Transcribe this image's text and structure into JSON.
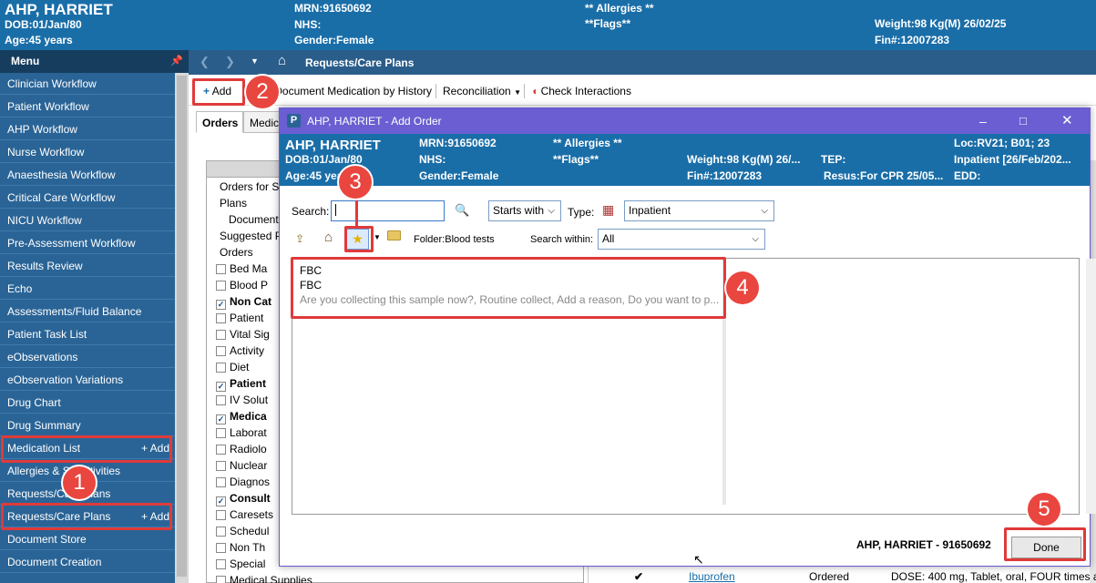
{
  "banner": {
    "name": "AHP, HARRIET",
    "dob": "DOB:01/Jan/80",
    "age": "Age:45 years",
    "mrn": "MRN:91650692",
    "nhs": "NHS:",
    "gender": "Gender:Female",
    "allergies": "** Allergies **",
    "flags": "**Flags**",
    "weight": "Weight:98 Kg(M) 26/02/25",
    "fin": "Fin#:12007283"
  },
  "sidebar": {
    "menu_label": "Menu",
    "add_label": "Add",
    "items": [
      {
        "label": "Clinician Workflow"
      },
      {
        "label": "Patient Workflow"
      },
      {
        "label": "AHP Workflow"
      },
      {
        "label": "Nurse Workflow"
      },
      {
        "label": "Anaesthesia Workflow"
      },
      {
        "label": "Critical Care Workflow"
      },
      {
        "label": "NICU Workflow"
      },
      {
        "label": "Pre-Assessment Workflow"
      },
      {
        "label": "Results Review"
      },
      {
        "label": "Echo"
      },
      {
        "label": "Assessments/Fluid Balance"
      },
      {
        "label": "Patient Task List"
      },
      {
        "label": "eObservations"
      },
      {
        "label": "eObservation Variations"
      },
      {
        "label": "Drug Chart"
      },
      {
        "label": "Drug Summary"
      },
      {
        "label": "Medication List"
      },
      {
        "label": "Allergies & Sensitivities"
      },
      {
        "label": "Requests/Care Plans"
      },
      {
        "label": "Requests/Care Plans"
      },
      {
        "label": "Document Store"
      },
      {
        "label": "Document Creation"
      }
    ]
  },
  "main": {
    "page_title": "Requests/Care Plans",
    "toolbar": {
      "add": "Add",
      "document_medication": "Document Medication by History",
      "reconciliation": "Reconciliation",
      "check_interactions": "Check Interactions"
    },
    "tabs": [
      "Orders",
      "Medic"
    ],
    "tree": [
      {
        "label": "Orders for Si",
        "type": "node"
      },
      {
        "label": "Plans",
        "type": "node"
      },
      {
        "label": "Document",
        "type": "node"
      },
      {
        "label": "Suggested P",
        "type": "node"
      },
      {
        "label": "Orders",
        "type": "node"
      },
      {
        "label": "Bed Ma",
        "checked": false,
        "bold": false
      },
      {
        "label": "Blood P",
        "checked": false,
        "bold": false
      },
      {
        "label": "Non Cat",
        "checked": true,
        "bold": true
      },
      {
        "label": "Patient",
        "checked": false,
        "bold": false
      },
      {
        "label": "Vital Sig",
        "checked": false,
        "bold": false
      },
      {
        "label": "Activity",
        "checked": false,
        "bold": false
      },
      {
        "label": "Diet",
        "checked": false,
        "bold": false
      },
      {
        "label": "Patient",
        "checked": true,
        "bold": true
      },
      {
        "label": "IV Solut",
        "checked": false,
        "bold": false
      },
      {
        "label": "Medica",
        "checked": true,
        "bold": true
      },
      {
        "label": "Laborat",
        "checked": false,
        "bold": false
      },
      {
        "label": "Radiolo",
        "checked": false,
        "bold": false
      },
      {
        "label": "Nuclear",
        "checked": false,
        "bold": false
      },
      {
        "label": "Diagnos",
        "checked": false,
        "bold": false
      },
      {
        "label": "Consult",
        "checked": true,
        "bold": true
      },
      {
        "label": "Caresets",
        "checked": false,
        "bold": false
      },
      {
        "label": "Schedul",
        "checked": false,
        "bold": false
      },
      {
        "label": "Non Th",
        "checked": false,
        "bold": false
      },
      {
        "label": "Special",
        "checked": false,
        "bold": false
      },
      {
        "label": "Medical Supplies",
        "checked": false,
        "bold": false
      }
    ],
    "bottom_row": {
      "drug": "Ibuprofen",
      "status": "Ordered",
      "details": "DOSE: 400 mg, Tablet, oral, FOUR times a"
    }
  },
  "dialog": {
    "title": "AHP, HARRIET  - Add Order",
    "banner": {
      "name": "AHP, HARRIET",
      "dob": "DOB:01/Jan/80",
      "age": "Age:45 years",
      "mrn": "MRN:91650692",
      "nhs": "NHS:",
      "gender": "Gender:Female",
      "allergies": "** Allergies **",
      "flags": "**Flags**",
      "weight": "Weight:98 Kg(M) 26/...",
      "fin": "Fin#:12007283",
      "tep": "TEP:",
      "resus": "Resus:For CPR  25/05...",
      "loc": "Loc:RV21; B01; 23",
      "inpatient": "Inpatient [26/Feb/202...",
      "edd": "EDD:"
    },
    "search_label": "Search:",
    "search_value": "",
    "match_mode": "Starts with",
    "type_label": "Type:",
    "type_value": "Inpatient",
    "folder_label": "Folder:",
    "folder_value": "Blood tests",
    "search_within_label": "Search within:",
    "search_within_value": "All",
    "results": {
      "title": "FBC",
      "name": "FBC",
      "detail": "Are you collecting this sample now?, Routine collect, Add a reason, Do you want to p..."
    },
    "footer_patient": "AHP, HARRIET   - 91650692",
    "done": "Done"
  },
  "annotations": [
    "1",
    "2",
    "3",
    "4",
    "5"
  ],
  "colors": {
    "banner": "#1a6ea8",
    "sidebar": "#2a6496",
    "dialog_title": "#6a5ed2",
    "highlight": "#e03a3a"
  }
}
